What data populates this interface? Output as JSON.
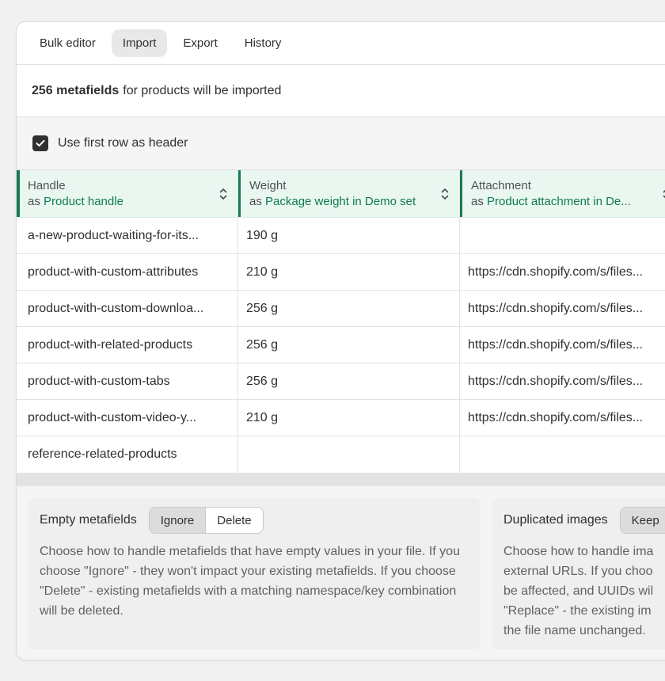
{
  "tabs": [
    "Bulk editor",
    "Import",
    "Export",
    "History"
  ],
  "active_tab": "Import",
  "summary": {
    "count": "256 metafields",
    "text": "for products will be imported"
  },
  "header_option": {
    "label": "Use first row as header",
    "checked": true
  },
  "columns": [
    {
      "title": "Handle",
      "as": "as",
      "mapping": "Product handle"
    },
    {
      "title": "Weight",
      "as": "as",
      "mapping": "Package weight in Demo set"
    },
    {
      "title": "Attachment",
      "as": "as",
      "mapping": "Product attachment in De..."
    }
  ],
  "rows": [
    [
      "a-new-product-waiting-for-its...",
      "190 g",
      ""
    ],
    [
      "product-with-custom-attributes",
      "210 g",
      "https://cdn.shopify.com/s/files..."
    ],
    [
      "product-with-custom-downloa...",
      "256 g",
      "https://cdn.shopify.com/s/files..."
    ],
    [
      "product-with-related-products",
      "256 g",
      "https://cdn.shopify.com/s/files..."
    ],
    [
      "product-with-custom-tabs",
      "256 g",
      "https://cdn.shopify.com/s/files..."
    ],
    [
      "product-with-custom-video-y...",
      "210 g",
      "https://cdn.shopify.com/s/files..."
    ],
    [
      "reference-related-products",
      "",
      ""
    ]
  ],
  "empty_metafields": {
    "label": "Empty metafields",
    "options": [
      "Ignore",
      "Delete"
    ],
    "selected": "Ignore",
    "description": "Choose how to handle metafields that have empty values in your file. If you choose \"Ignore\" - they won't impact your existing metafields. If you choose \"Delete\" - existing metafields with a matching namespace/key combination will be deleted."
  },
  "duplicated_images": {
    "label": "Duplicated images",
    "option": "Keep",
    "description_lines": [
      "Choose how to handle ima",
      "external URLs. If you choo",
      "be affected, and UUIDs wil",
      "\"Replace\" - the existing im",
      "the file name unchanged."
    ]
  },
  "colors": {
    "accent": "#1a7a55",
    "mapping_text": "#0f7a52",
    "header_bg": "#eaf7f1"
  },
  "icons": {
    "checkbox": "checkmark-icon",
    "sort": "sort-icon"
  }
}
